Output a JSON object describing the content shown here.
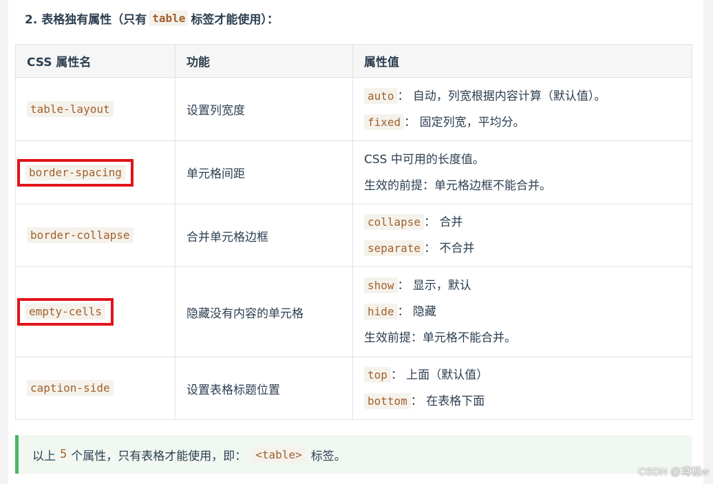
{
  "heading": {
    "prefix": "2. 表格独有属性（只有",
    "code": "table",
    "suffix": "标签才能使用）："
  },
  "table": {
    "headers": [
      "CSS 属性名",
      "功能",
      "属性值"
    ],
    "rows": [
      {
        "property": "table-layout",
        "function": "设置列宽度",
        "values": [
          {
            "code": "auto",
            "text": "： 自动，列宽根据内容计算（默认值）。"
          },
          {
            "code": "fixed",
            "text": "： 固定列宽，平均分。"
          }
        ]
      },
      {
        "property": "border-spacing",
        "function": "单元格间距",
        "values": [
          {
            "code": "",
            "text": "CSS 中可用的长度值。"
          },
          {
            "code": "",
            "text": "生效的前提：单元格边框不能合并。"
          }
        ]
      },
      {
        "property": "border-collapse",
        "function": "合并单元格边框",
        "values": [
          {
            "code": "collapse",
            "text": "： 合并"
          },
          {
            "code": "separate",
            "text": "： 不合并"
          }
        ]
      },
      {
        "property": "empty-cells",
        "function": "隐藏没有内容的单元格",
        "values": [
          {
            "code": "show",
            "text": "： 显示，默认"
          },
          {
            "code": "hide",
            "text": "： 隐藏"
          },
          {
            "code": "",
            "text": "生效前提：单元格不能合并。"
          }
        ]
      },
      {
        "property": "caption-side",
        "function": "设置表格标题位置",
        "values": [
          {
            "code": "top",
            "text": "： 上面（默认值）"
          },
          {
            "code": "bottom",
            "text": "： 在表格下面"
          }
        ]
      }
    ]
  },
  "note": {
    "prefix": "以上",
    "count": "5",
    "middle": "个属性，只有表格才能使用，即：",
    "code": "<table>",
    "suffix": "标签。"
  },
  "watermark": "CSDN @鸢栀w",
  "colors": {
    "highlight_box": "#e0131a",
    "code_text": "#a1602c",
    "note_border": "#4fb564"
  }
}
